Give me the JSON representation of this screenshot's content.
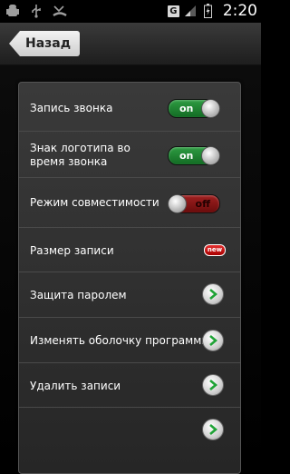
{
  "status_bar": {
    "time": "2:20",
    "network_badge": "G"
  },
  "header": {
    "back_label": "Назад"
  },
  "settings": {
    "call_recording": {
      "label": "Запись звонка",
      "toggle": "on"
    },
    "logo_during_call": {
      "label": "Знак логотипа во время звонка",
      "toggle": "on"
    },
    "compatibility_mode": {
      "label": "Режим совместимости",
      "toggle": "off"
    },
    "recording_size": {
      "label": "Размер записи",
      "badge": "new"
    },
    "password_protection": {
      "label": "Защита паролем"
    },
    "change_skin": {
      "label": "Изменять оболочку программы"
    },
    "delete_records": {
      "label": "Удалить записи"
    }
  },
  "colors": {
    "toggle_on": "#1f8a35",
    "toggle_off": "#8a1010",
    "accent_green": "#23a23a"
  },
  "icons": [
    "android-debug-icon",
    "usb-icon",
    "missed-call-icon",
    "battery-icon",
    "chevron-right-icon"
  ]
}
